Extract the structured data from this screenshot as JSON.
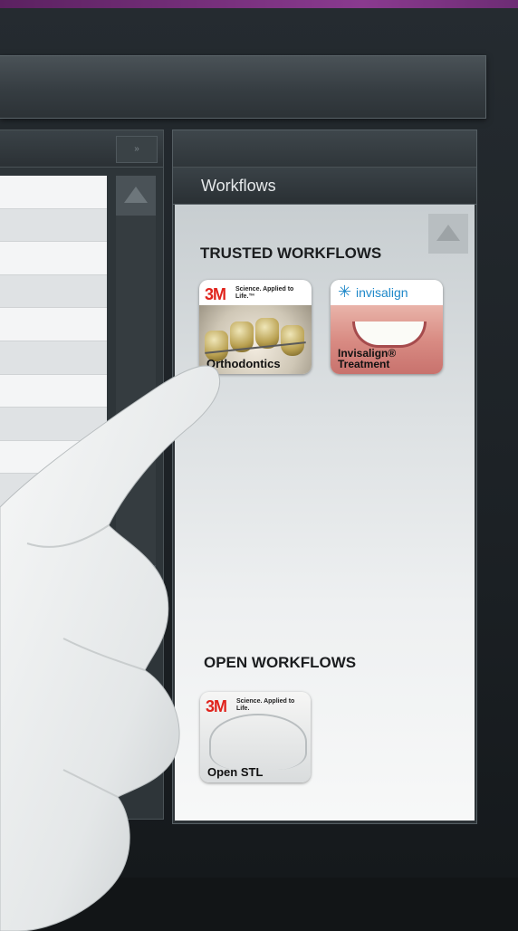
{
  "workflows_panel": {
    "title": "Workflows",
    "trusted_section_title": "TRUSTED WORKFLOWS",
    "open_section_title": "OPEN WORKFLOWS",
    "trusted_tiles": [
      {
        "brand_logo": "3M",
        "brand_tagline": "Science. Applied to Life.™",
        "label": "Orthodontics"
      },
      {
        "brand_logo": "invisalign",
        "label_line1": "Invisalign®",
        "label_line2": "Treatment"
      }
    ],
    "open_tiles": [
      {
        "brand_logo": "3M",
        "brand_tagline": "Science. Applied to Life.",
        "label": "Open STL"
      }
    ]
  },
  "list_panel": {
    "collapse_glyph": "»",
    "row_count": 13
  },
  "colors": {
    "accent_bar": "#8a3a8f",
    "brand_3m": "#e0231c",
    "brand_invisalign": "#1e88c9"
  }
}
